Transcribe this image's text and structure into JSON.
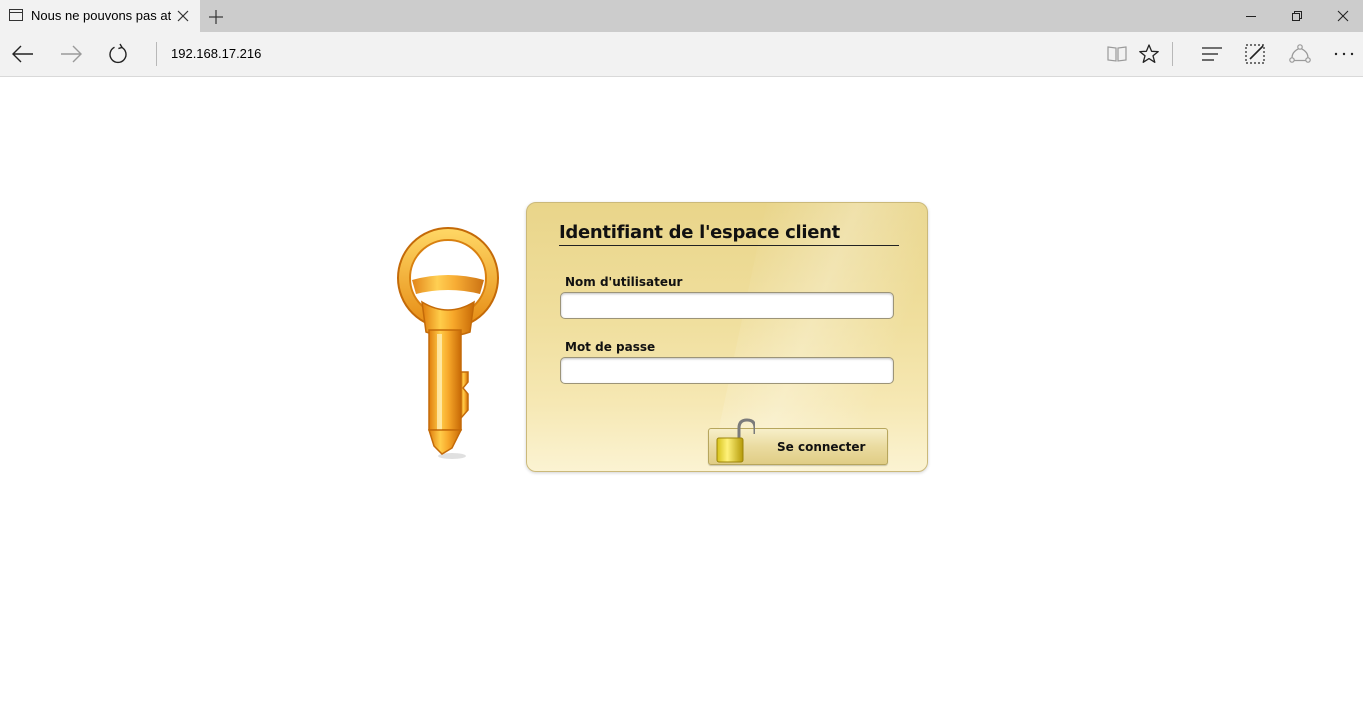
{
  "browser": {
    "tab_title": "Nous ne pouvons pas at",
    "address": "192.168.17.216"
  },
  "login": {
    "title": "Identifiant de l'espace client",
    "username_label": "Nom d'utilisateur",
    "username_value": "",
    "password_label": "Mot de passe",
    "password_value": "",
    "submit_label": "Se connecter"
  },
  "colors": {
    "panel_top": "#e9d58a",
    "panel_bottom": "#fbf3d2",
    "key_gold": "#f3a21f"
  }
}
